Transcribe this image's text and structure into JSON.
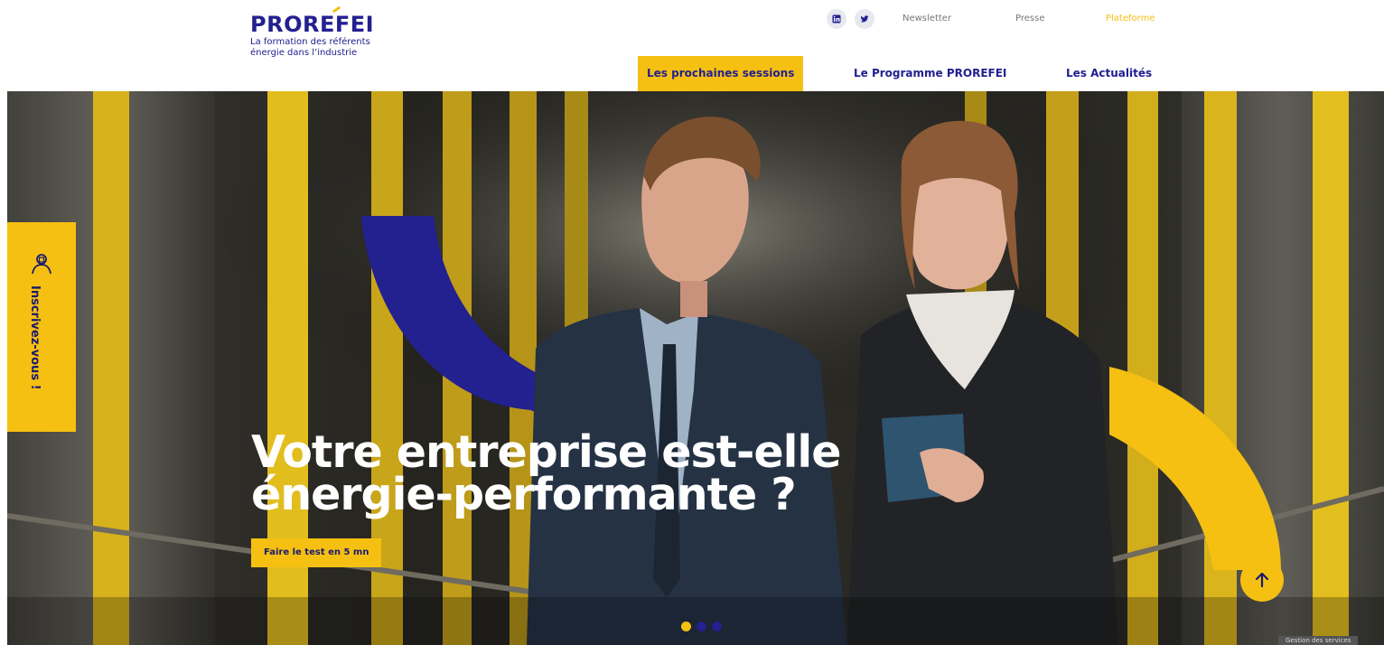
{
  "brand": {
    "name": "PROREFEI",
    "tagline_line1": "La formation des référents",
    "tagline_line2": "énergie dans l’industrie"
  },
  "top_links": {
    "newsletter": "Newsletter",
    "presse": "Presse",
    "plateforme": "Plateforme"
  },
  "social": [
    "linkedin-icon",
    "twitter-icon"
  ],
  "nav": {
    "sessions": "Les prochaines sessions",
    "programme": "Le Programme PROREFEI",
    "actualites": "Les Actualités"
  },
  "hero": {
    "title_line1": "Votre entreprise est-elle",
    "title_line2": "énergie-performante ?",
    "cta": "Faire le test en 5 mn",
    "slide_count": 3,
    "active_slide": 1
  },
  "side_tab": {
    "label": "Inscrivez-vous !",
    "icon": "user-icon"
  },
  "footer": {
    "cookies": "Gestion des services"
  },
  "colors": {
    "yellow": "#f5c012",
    "navy": "#23208f",
    "text_dark": "#1a1a6e"
  }
}
